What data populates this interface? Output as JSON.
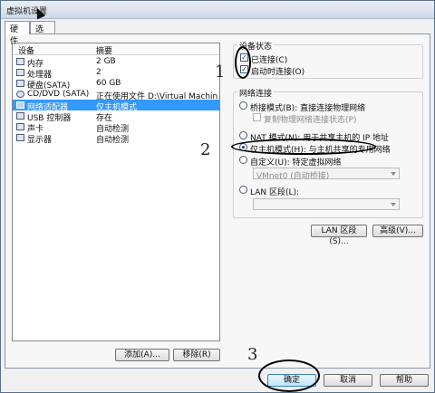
{
  "window": {
    "title": "虚拟机设置"
  },
  "tabs": [
    {
      "label": "硬件"
    },
    {
      "label": "选项"
    }
  ],
  "devices": {
    "headers": {
      "device": "设备",
      "summary": "摘要"
    },
    "items": [
      {
        "name": "内存",
        "summary": "2 GB"
      },
      {
        "name": "处理器",
        "summary": "2"
      },
      {
        "name": "硬盘(SATA)",
        "summary": "60 GB"
      },
      {
        "name": "CD/DVD (SATA)",
        "summary": "正在使用文件 D:\\Virtual Machines\\d..."
      },
      {
        "name": "网络适配器",
        "summary": "仅主机模式"
      },
      {
        "name": "USB 控制器",
        "summary": "存在"
      },
      {
        "name": "声卡",
        "summary": "自动检测"
      },
      {
        "name": "显示器",
        "summary": "自动检测"
      }
    ],
    "add_label": "添加(A)...",
    "remove_label": "移除(R)"
  },
  "device_status": {
    "title": "设备状态",
    "connected": "已连接(C)",
    "connect_on_power": "启动时连接(O)"
  },
  "network": {
    "title": "网络连接",
    "bridged": "桥接模式(B): 直接连接物理网络",
    "replicate": "复制物理网络连接状态(P)",
    "nat": "NAT 模式(N): 用于共享主机的 IP 地址",
    "host_only": "仅主机模式(H): 与主机共享的专用网络",
    "custom": "自定义(U): 特定虚拟网络",
    "custom_select": "VMnet0 (自动桥接)",
    "lan": "LAN 区段(L):",
    "lan_select": "",
    "lan_btn": "LAN 区段(S)...",
    "advanced_btn": "高级(V)..."
  },
  "footer": {
    "ok": "确定",
    "cancel": "取消",
    "help": "帮助"
  },
  "annotations": {
    "n1": "1",
    "n2": "2",
    "n3": "3"
  },
  "colors": {
    "selection": "#3399ff",
    "ring": "#000000"
  }
}
